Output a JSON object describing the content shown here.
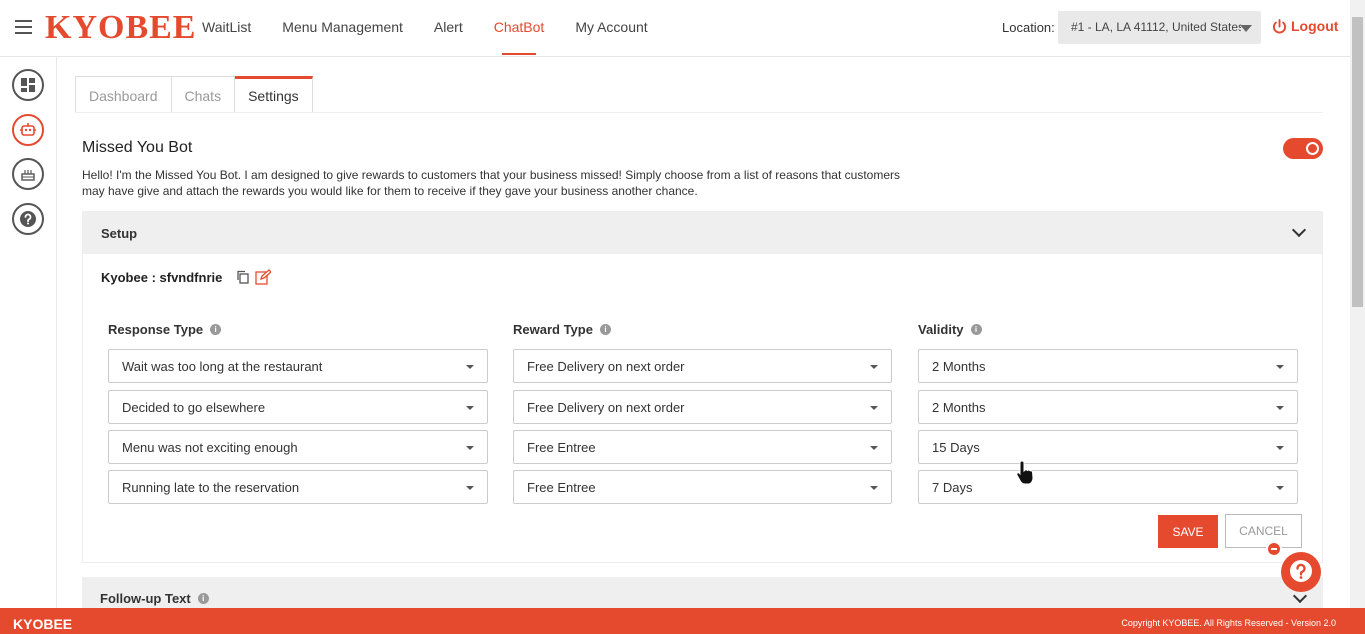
{
  "brand": "KYOBEE",
  "nav": {
    "items": [
      "WaitList",
      "Menu Management",
      "Alert",
      "ChatBot",
      "My Account"
    ],
    "active": "ChatBot"
  },
  "location": {
    "label": "Location:",
    "value": "#1 - LA, LA 41112, United States"
  },
  "logout_label": "Logout",
  "sidebar": {
    "icons": [
      "dashboard-icon",
      "chatbot-icon",
      "cake-icon",
      "help-icon"
    ]
  },
  "tabs": [
    "Dashboard",
    "Chats",
    "Settings"
  ],
  "active_tab": "Settings",
  "bot": {
    "title": "Missed You Bot",
    "enabled": true,
    "description": "Hello! I'm the Missed You Bot. I am designed to give rewards to customers that your business missed! Simply choose from a list of reasons that customers may have give and attach the rewards you would like for them to receive if they gave your business another chance."
  },
  "setup": {
    "title": "Setup",
    "kyobee_label": "Kyobee : sfvndfnrie",
    "columns": {
      "response": "Response Type",
      "reward": "Reward Type",
      "validity": "Validity"
    },
    "rows": [
      {
        "response": "Wait was too long at the restaurant",
        "reward": "Free Delivery on next order",
        "validity": "2 Months"
      },
      {
        "response": "Decided to go elsewhere",
        "reward": "Free Delivery on next order",
        "validity": "2 Months"
      },
      {
        "response": "Menu was not exciting enough",
        "reward": "Free Entree",
        "validity": "15 Days"
      },
      {
        "response": "Running late to the reservation",
        "reward": "Free Entree",
        "validity": "7 Days"
      }
    ],
    "save_label": "SAVE",
    "cancel_label": "CANCEL"
  },
  "followup": {
    "title": "Follow-up Text"
  },
  "footer": {
    "logo": "KYOBEE",
    "copyright": "Copyright KYOBEE. All Rights Reserved - Version 2.0"
  },
  "colors": {
    "accent": "#e64a2e"
  }
}
